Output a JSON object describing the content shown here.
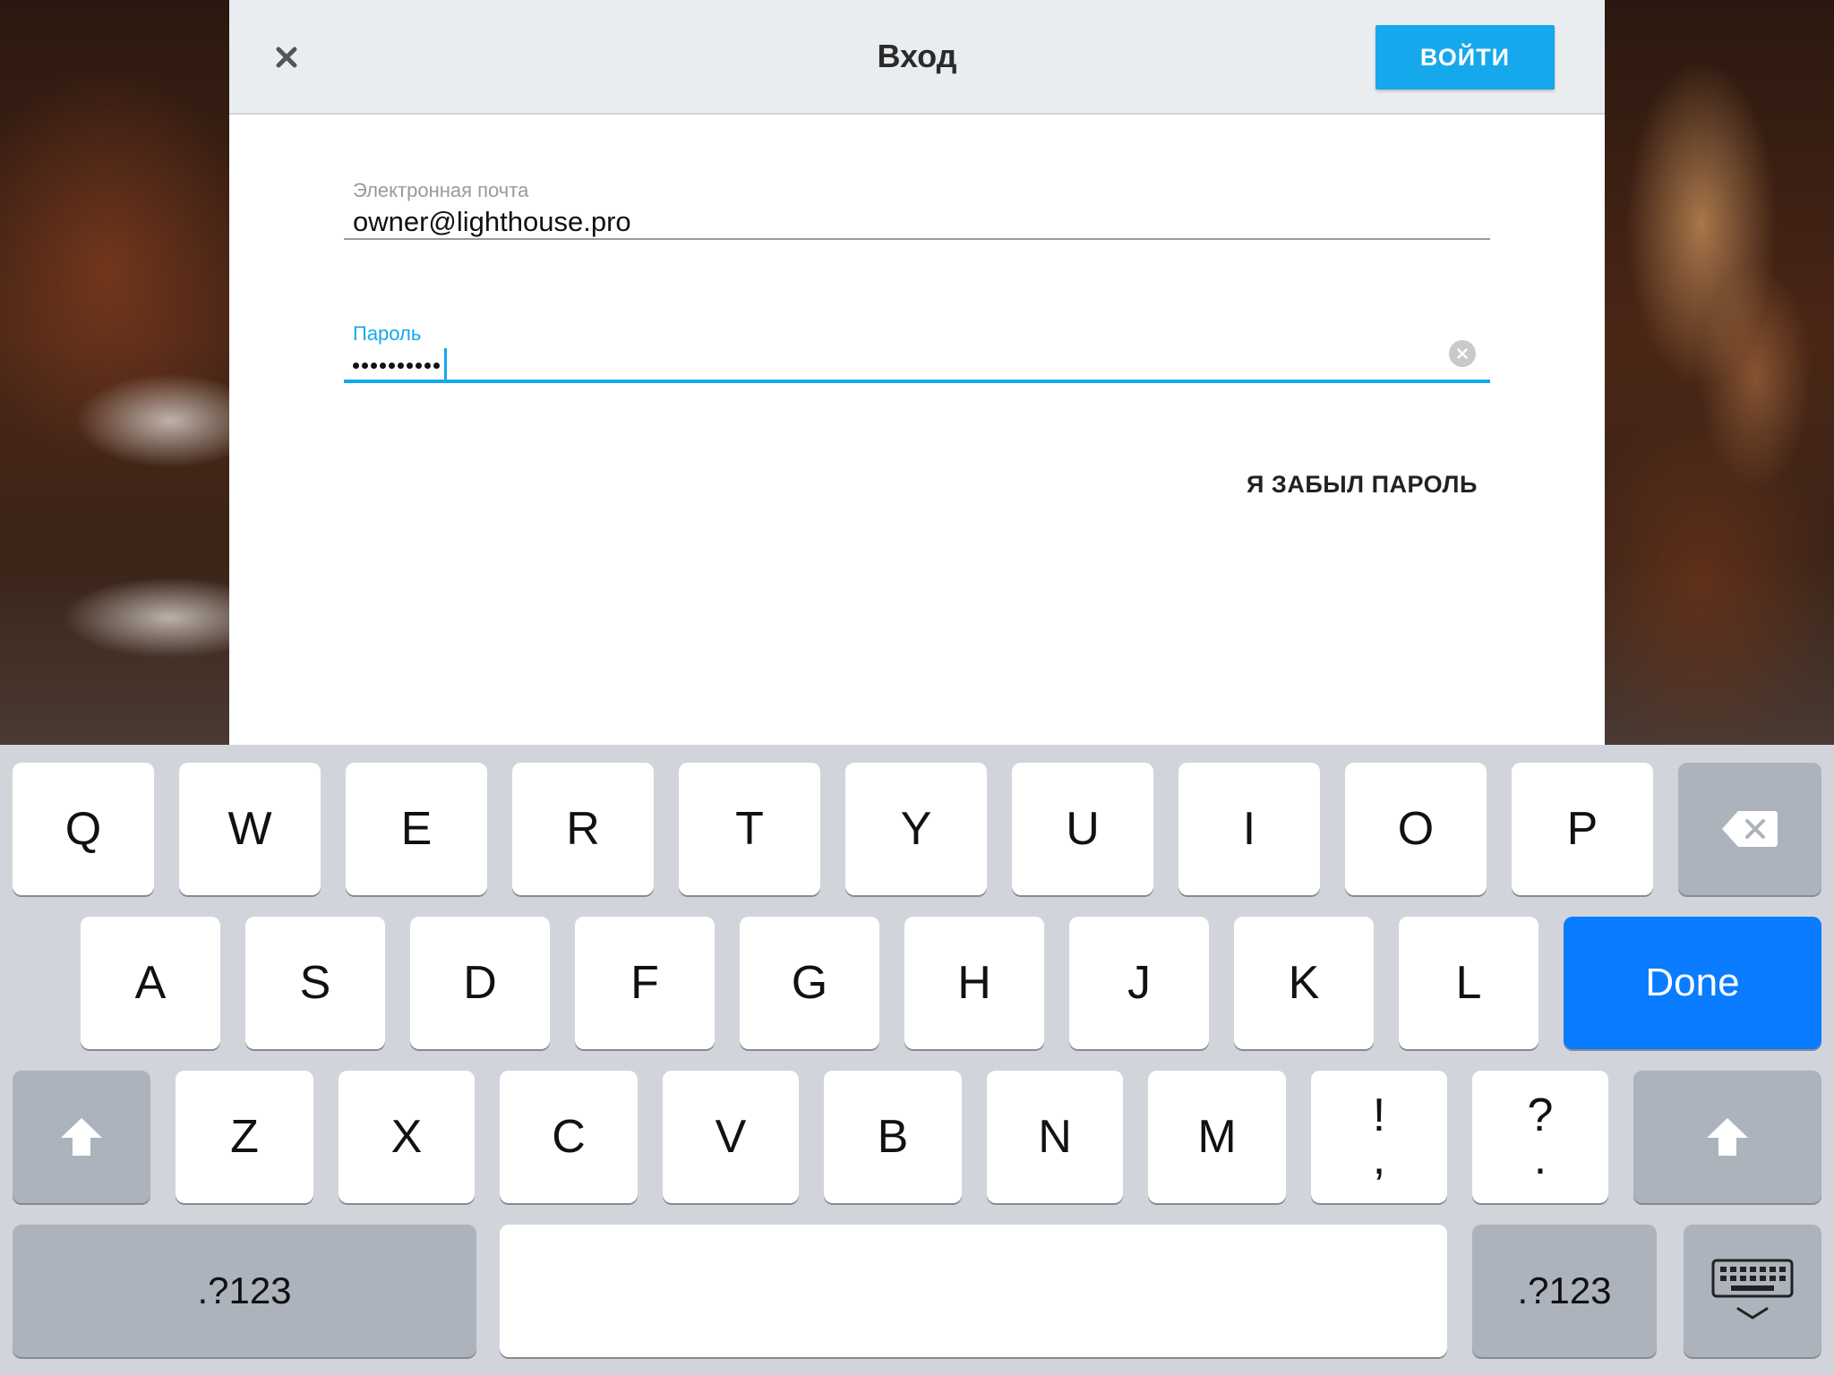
{
  "dialog": {
    "title": "Вход",
    "close_icon": "close-icon",
    "login_label": "ВОЙТИ",
    "accent_color": "#16a8ec"
  },
  "form": {
    "email": {
      "label": "Электронная почта",
      "value": "owner@lighthouse.pro"
    },
    "password": {
      "label": "Пароль",
      "masked_length": 10,
      "clear_icon": "clear-icon"
    },
    "forgot_label": "Я ЗАБЫЛ ПАРОЛЬ"
  },
  "keyboard": {
    "row1": [
      "Q",
      "W",
      "E",
      "R",
      "T",
      "Y",
      "U",
      "I",
      "O",
      "P"
    ],
    "row2": [
      "A",
      "S",
      "D",
      "F",
      "G",
      "H",
      "J",
      "K",
      "L"
    ],
    "row3": [
      "Z",
      "X",
      "C",
      "V",
      "B",
      "N",
      "M"
    ],
    "punct1": {
      "top": "!",
      "bottom": ","
    },
    "punct2": {
      "top": "?",
      "bottom": "."
    },
    "done_label": "Done",
    "done_color": "#0a7cff",
    "mode_label": ".?123",
    "icons": {
      "backspace": "backspace-icon",
      "shift": "shift-icon",
      "dismiss": "keyboard-dismiss-icon"
    }
  }
}
